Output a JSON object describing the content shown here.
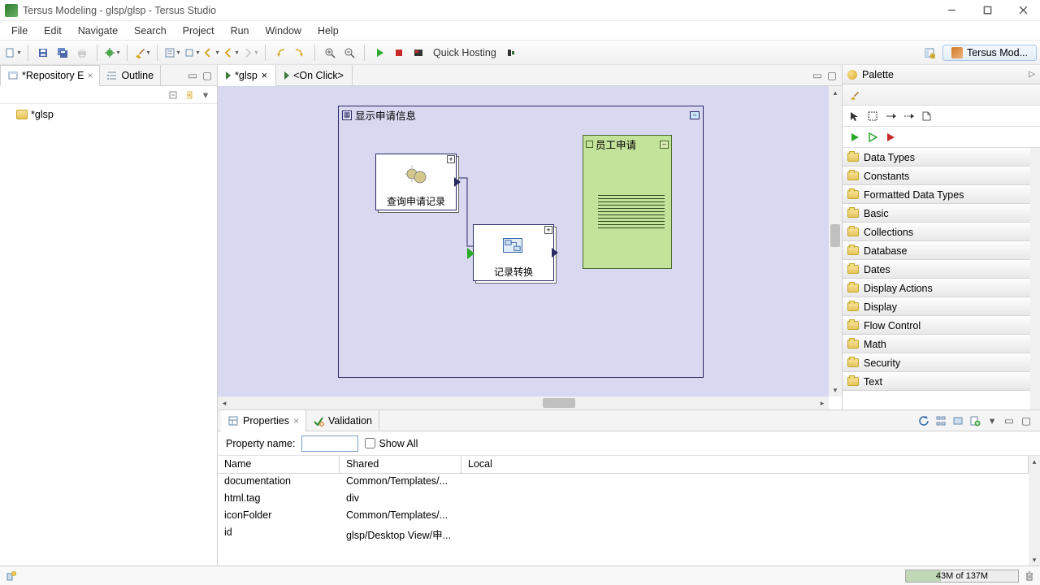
{
  "window": {
    "title": "Tersus Modeling - glsp/glsp - Tersus Studio"
  },
  "menu": [
    "File",
    "Edit",
    "Navigate",
    "Search",
    "Project",
    "Run",
    "Window",
    "Help"
  ],
  "toolbar": {
    "quick_hosting": "Quick Hosting"
  },
  "perspective": {
    "label": "Tersus Mod..."
  },
  "left_views": {
    "repo_tab": "*Repository E",
    "outline_tab": "Outline",
    "tree_root": "*glsp"
  },
  "editor": {
    "tab1": "*glsp",
    "tab2": "<On Click>",
    "main_model_title": "显示申请信息",
    "box_a": "查询申请记录",
    "box_b": "记录转换",
    "green_box": "员工申请"
  },
  "palette": {
    "title": "Palette",
    "categories": [
      "Data Types",
      "Constants",
      "Formatted Data Types",
      "Basic",
      "Collections",
      "Database",
      "Dates",
      "Display Actions",
      "Display",
      "Flow Control",
      "Math",
      "Security",
      "Text"
    ]
  },
  "bottom": {
    "properties_tab": "Properties",
    "validation_tab": "Validation",
    "propname_label": "Property name:",
    "showall_label": "Show All",
    "cols": {
      "name": "Name",
      "shared": "Shared",
      "local": "Local"
    },
    "rows": [
      {
        "name": "documentation",
        "shared": "Common/Templates/...",
        "local": ""
      },
      {
        "name": "html.tag",
        "shared": "div",
        "local": ""
      },
      {
        "name": "iconFolder",
        "shared": "Common/Templates/...",
        "local": ""
      },
      {
        "name": "id",
        "shared": "glsp/Desktop View/申...",
        "local": ""
      }
    ]
  },
  "status": {
    "heap": "43M of 137M"
  }
}
